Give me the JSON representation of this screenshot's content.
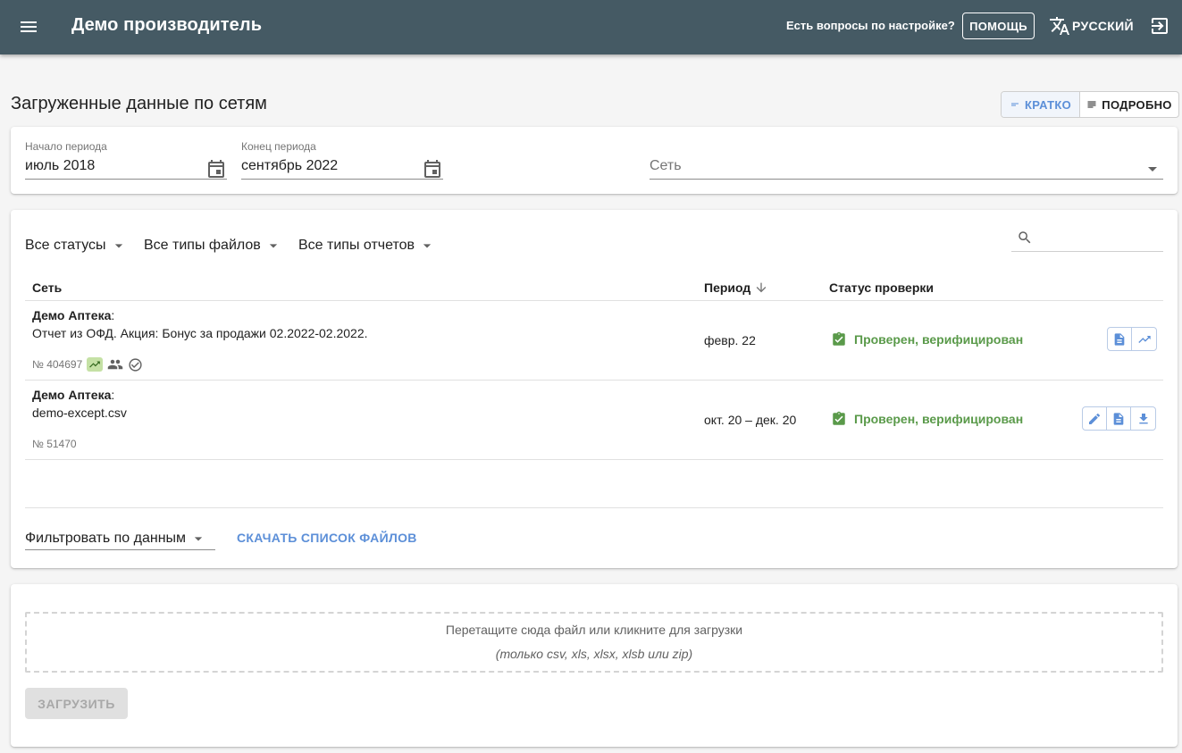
{
  "header": {
    "app_title": "Демо производитель",
    "help_question": "Есть вопросы по настройке?",
    "help_button": "ПОМОЩЬ",
    "language": "РУССКИЙ"
  },
  "page": {
    "title": "Загруженные данные по сетям",
    "view_short": "КРАТКО",
    "view_long": "ПОДРОБНО"
  },
  "filters": {
    "period_start_label": "Начало периода",
    "period_start_value": "июль 2018",
    "period_end_label": "Конец периода",
    "period_end_value": "сентябрь 2022",
    "network_placeholder": "Сеть"
  },
  "table": {
    "status_filter": "Все статусы",
    "file_type_filter": "Все типы файлов",
    "report_type_filter": "Все типы отчетов",
    "col_network": "Сеть",
    "col_period": "Период",
    "col_status": "Статус проверки",
    "rows": [
      {
        "network": "Демо Аптека",
        "file": "Отчет из ОФД. Акция: Бонус за продажи 02.2022-02.2022.",
        "number": "№ 404697",
        "period": "февр. 22",
        "status": "Проверен, верифицирован"
      },
      {
        "network": "Демо Аптека",
        "file": "demo-except.csv",
        "number": "№ 51470",
        "period": "окт. 20 – дек. 20",
        "status": "Проверен, верифицирован"
      }
    ],
    "filter_by_data": "Фильтровать по данным",
    "download_list": "СКАЧАТЬ СПИСОК ФАЙЛОВ"
  },
  "upload": {
    "drop_text": "Перетащите сюда файл или кликните для загрузки",
    "formats": "(только csv, xls, xlsx, xlsb или zip)",
    "upload_button": "ЗАГРУЗИТЬ"
  },
  "colors": {
    "topbar": "#455a64",
    "accent": "#5c8fd8",
    "status_ok": "#5a9a4a"
  }
}
